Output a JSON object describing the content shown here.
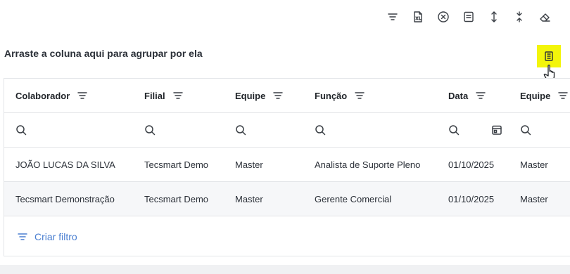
{
  "toolbar": {
    "icons": [
      "filter-lines-icon",
      "export-xls-icon",
      "clear-circle-icon",
      "document-icon",
      "expand-vertical-icon",
      "collapse-vertical-icon",
      "eraser-icon"
    ]
  },
  "group_bar": {
    "text": "Arraste a coluna aqui para agrupar por ela"
  },
  "grid": {
    "columns": [
      "Colaborador",
      "Filial",
      "Equipe",
      "Função",
      "Data",
      "Equipe"
    ],
    "rows": [
      [
        "JOÃO LUCAS DA SILVA",
        "Tecsmart Demo",
        "Master",
        "Analista de Suporte Pleno",
        "01/10/2025",
        "Master"
      ],
      [
        "Tecsmart Demonstração",
        "Tecsmart Demo",
        "Master",
        "Gerente Comercial",
        "01/10/2025",
        "Master"
      ]
    ],
    "create_filter_label": "Criar filtro"
  },
  "colors": {
    "highlight": "#f3f50a",
    "link": "#4a7fd1",
    "alt_row": "#f6f7f9"
  }
}
